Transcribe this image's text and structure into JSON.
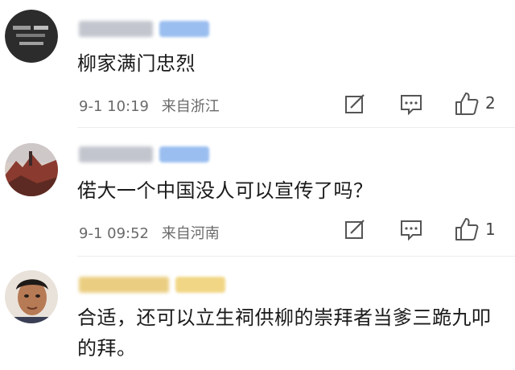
{
  "comments": [
    {
      "text": "柳家满门忠烈",
      "time": "9-1 10:19",
      "location": "来自浙江",
      "likes": "2",
      "avatar_icon": "dark-text-avatar-icon"
    },
    {
      "text": "偌大一个中国没人可以宣传了吗？",
      "time": "9-1 09:52",
      "location": "来自河南",
      "likes": "1",
      "avatar_icon": "landscape-photo-avatar-icon"
    },
    {
      "text": "合适，还可以立生祠供柳的崇拜者当爹三跪九叩的拜。",
      "avatar_icon": "person-portrait-avatar-icon"
    }
  ],
  "colors": {
    "badge_blue": "#8fb7ee",
    "badge_gold": "#f0d27a",
    "name_gray": "#b9bcc6",
    "name_gold": "#e7c56b",
    "meta_text": "#6a6a6a",
    "icon_stroke": "#555555"
  }
}
